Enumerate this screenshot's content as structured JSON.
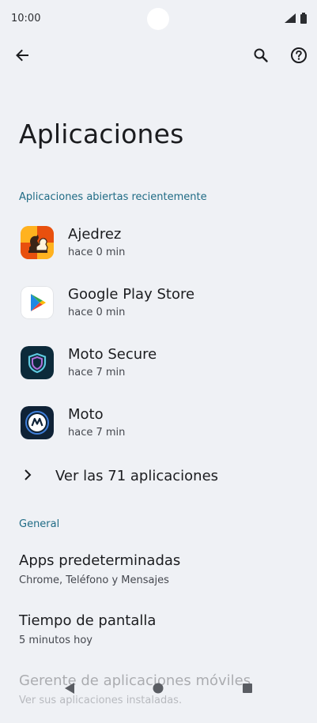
{
  "status": {
    "time": "10:00"
  },
  "page": {
    "title": "Aplicaciones"
  },
  "recent": {
    "header": "Aplicaciones abiertas recientemente",
    "apps": [
      {
        "name": "Ajedrez",
        "time": "hace 0 min",
        "icon": "chess-app-icon"
      },
      {
        "name": "Google Play Store",
        "time": "hace 0 min",
        "icon": "play-store-icon"
      },
      {
        "name": "Moto Secure",
        "time": "hace 7 min",
        "icon": "moto-secure-icon"
      },
      {
        "name": "Moto",
        "time": "hace 7 min",
        "icon": "moto-app-icon"
      }
    ],
    "see_all": "Ver las 71 aplicaciones"
  },
  "general": {
    "header": "General",
    "items": [
      {
        "title": "Apps predeterminadas",
        "subtitle": "Chrome, Teléfono y Mensajes"
      },
      {
        "title": "Tiempo de pantalla",
        "subtitle": "5 minutos hoy"
      },
      {
        "title": "Gerente de aplicaciones móviles",
        "subtitle": "Ver sus aplicaciones instaladas."
      }
    ]
  },
  "colors": {
    "background": "#eff1f5",
    "accent": "#1f6b85"
  }
}
